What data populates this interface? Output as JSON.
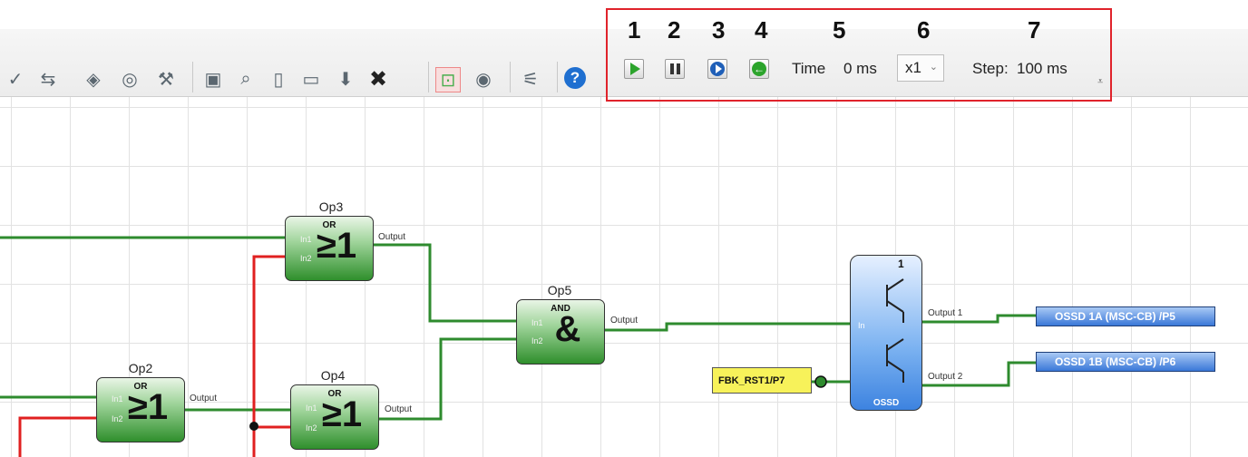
{
  "toolbar": {
    "icons": [
      "check-icon",
      "swap-icon",
      "cube-icon",
      "record-icon",
      "wand-icon",
      "monitor-chart-icon",
      "zoom-icon",
      "clipboard-icon",
      "display-icon",
      "download-icon",
      "delete-icon",
      "simulation-icon",
      "stop-icon",
      "no-link-icon",
      "help-icon"
    ]
  },
  "simulation": {
    "numbers": [
      "1",
      "2",
      "3",
      "4",
      "5",
      "6",
      "7"
    ],
    "time_label": "Time",
    "time_value": "0 ms",
    "speed": "x1",
    "step_label": "Step:",
    "step_value": "100 ms"
  },
  "blocks": {
    "op2": {
      "name": "Op2",
      "type": "OR",
      "symbol": "≥1",
      "in1": "In1",
      "in2": "In2",
      "out": "Output"
    },
    "op3": {
      "name": "Op3",
      "type": "OR",
      "symbol": "≥1",
      "in1": "In1",
      "in2": "In2",
      "out": "Output"
    },
    "op4": {
      "name": "Op4",
      "type": "OR",
      "symbol": "≥1",
      "in1": "In1",
      "in2": "In2",
      "out": "Output"
    },
    "op5": {
      "name": "Op5",
      "type": "AND",
      "symbol": "&",
      "in1": "In1",
      "in2": "In2",
      "out": "Output"
    },
    "ossd": {
      "name": "OSSD",
      "number": "1",
      "in": "In",
      "out1": "Output 1",
      "out2": "Output 2"
    }
  },
  "io": {
    "fbk": "FBK_RST1/P7",
    "out_a": "OSSD 1A (MSC-CB)  /P5",
    "out_b": "OSSD 1B (MSC-CB)  /P6"
  },
  "colors": {
    "wire_active": "#2e8b2e",
    "wire_inactive": "#e02020",
    "highlight": "#e0232b"
  }
}
